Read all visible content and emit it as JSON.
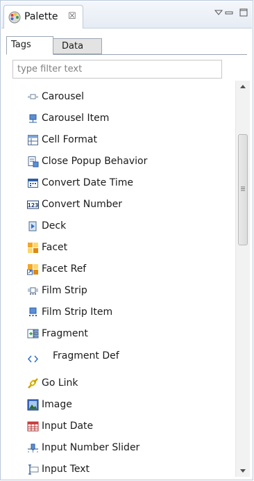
{
  "view": {
    "title": "Palette",
    "close_glyph": "☒",
    "toolbar_icons": [
      "view-menu-icon",
      "minimize-icon",
      "maximize-icon"
    ]
  },
  "tabs": [
    {
      "label": "Tags",
      "active": true
    },
    {
      "label": "Data",
      "active": false
    }
  ],
  "filter": {
    "placeholder": "type filter text",
    "value": ""
  },
  "items": [
    {
      "label": "Carousel",
      "icon": "carousel-icon"
    },
    {
      "label": "Carousel Item",
      "icon": "carousel-item-icon"
    },
    {
      "label": "Cell Format",
      "icon": "cell-format-icon"
    },
    {
      "label": "Close Popup Behavior",
      "icon": "close-popup-behavior-icon"
    },
    {
      "label": "Convert Date Time",
      "icon": "convert-date-time-icon"
    },
    {
      "label": "Convert Number",
      "icon": "convert-number-icon"
    },
    {
      "label": "Deck",
      "icon": "deck-icon"
    },
    {
      "label": "Facet",
      "icon": "facet-icon"
    },
    {
      "label": "Facet Ref",
      "icon": "facet-ref-icon"
    },
    {
      "label": "Film Strip",
      "icon": "film-strip-icon"
    },
    {
      "label": "Film Strip Item",
      "icon": "film-strip-item-icon"
    },
    {
      "label": "Fragment",
      "icon": "fragment-icon"
    },
    {
      "label": "Fragment Def",
      "icon": "fragment-def-icon"
    },
    {
      "label": "Go Link",
      "icon": "go-link-icon"
    },
    {
      "label": "Image",
      "icon": "image-icon"
    },
    {
      "label": "Input Date",
      "icon": "input-date-icon"
    },
    {
      "label": "Input Number Slider",
      "icon": "input-number-slider-icon"
    },
    {
      "label": "Input Text",
      "icon": "input-text-icon"
    }
  ],
  "number_icon_text": "123"
}
